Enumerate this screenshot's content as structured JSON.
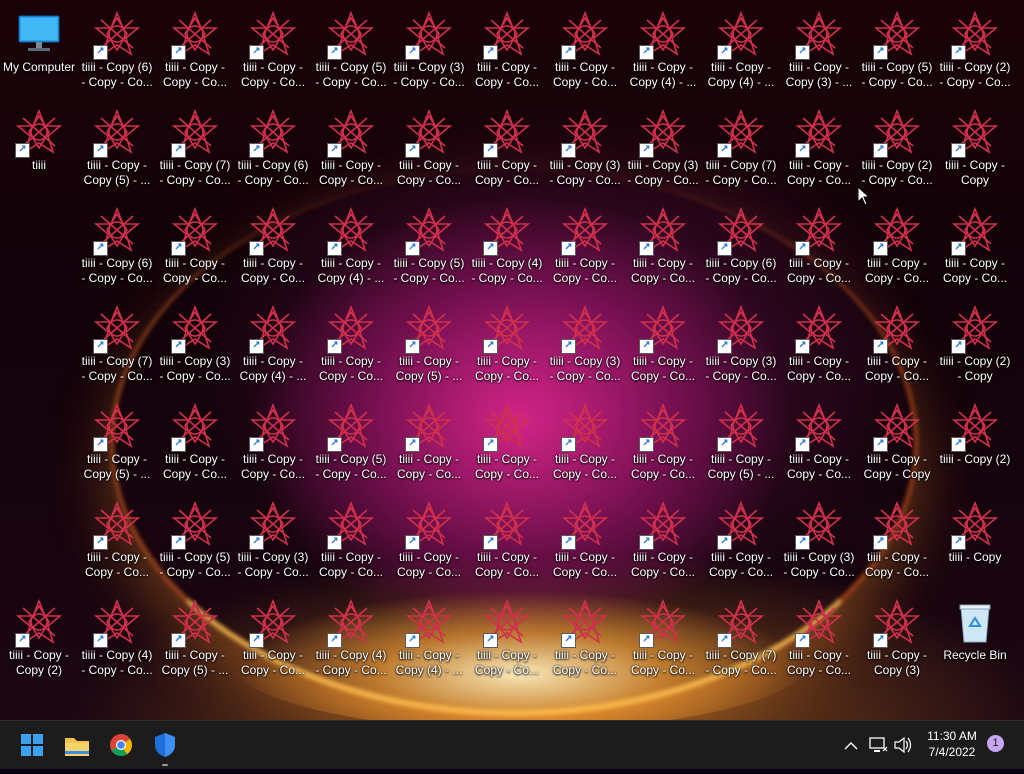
{
  "colors": {
    "taskbar": "#1c1c1c",
    "badge": "#c5a6f0"
  },
  "desktop": {
    "rows": [
      [
        "My Computer",
        "tiiii - Copy (6)\n- Copy - Co...",
        "tiiii - Copy -\nCopy - Co...",
        "tiiii - Copy -\nCopy - Co...",
        "tiiii - Copy (5)\n- Copy - Co...",
        "tiiii - Copy (3)\n- Copy - Co...",
        "tiiii - Copy -\nCopy - Co...",
        "tiiii - Copy -\nCopy - Co...",
        "tiiii - Copy -\nCopy (4) - ...",
        "tiiii - Copy -\nCopy (4) - ...",
        "tiiii - Copy -\nCopy (3) - ...",
        "tiiii - Copy (5)\n- Copy - Co...",
        "tiiii - Copy (2)\n- Copy - Co..."
      ],
      [
        "tiiii",
        "tiiii - Copy -\nCopy (5) - ...",
        "tiiii - Copy (7)\n- Copy - Co...",
        "tiiii - Copy (6)\n- Copy - Co...",
        "tiiii - Copy -\nCopy - Co...",
        "tiiii - Copy -\nCopy - Co...",
        "tiiii - Copy -\nCopy - Co...",
        "tiiii - Copy (3)\n- Copy - Co...",
        "tiiii - Copy (3)\n- Copy - Co...",
        "tiiii - Copy (7)\n- Copy - Co...",
        "tiiii - Copy -\nCopy - Co...",
        "tiiii - Copy (2)\n- Copy - Co...",
        "tiiii - Copy -\nCopy"
      ],
      [
        "",
        "tiiii - Copy (6)\n- Copy - Co...",
        "tiiii - Copy -\nCopy - Co...",
        "tiiii - Copy -\nCopy - Co...",
        "tiiii - Copy -\nCopy (4) - ...",
        "tiiii - Copy (5)\n- Copy - Co...",
        "tiiii - Copy (4)\n- Copy - Co...",
        "tiiii - Copy -\nCopy - Co...",
        "tiiii - Copy -\nCopy - Co...",
        "tiiii - Copy (6)\n- Copy - Co...",
        "tiiii - Copy -\nCopy - Co...",
        "tiiii - Copy -\nCopy - Co...",
        "tiiii - Copy -\nCopy - Co..."
      ],
      [
        "",
        "tiiii - Copy (7)\n- Copy - Co...",
        "tiiii - Copy (3)\n- Copy - Co...",
        "tiiii - Copy -\nCopy (4) - ...",
        "tiiii - Copy -\nCopy - Co...",
        "tiiii - Copy -\nCopy (5) - ...",
        "tiiii - Copy -\nCopy - Co...",
        "tiiii - Copy (3)\n- Copy - Co...",
        "tiiii - Copy -\nCopy - Co...",
        "tiiii - Copy (3)\n- Copy - Co...",
        "tiiii - Copy -\nCopy - Co...",
        "tiiii - Copy -\nCopy - Co...",
        "tiiii - Copy (2)\n- Copy"
      ],
      [
        "",
        "tiiii - Copy -\nCopy (5) - ...",
        "tiiii - Copy -\nCopy - Co...",
        "tiiii - Copy -\nCopy - Co...",
        "tiiii - Copy (5)\n- Copy - Co...",
        "tiiii - Copy -\nCopy - Co...",
        "tiiii - Copy -\nCopy - Co...",
        "tiiii - Copy -\nCopy - Co...",
        "tiiii - Copy -\nCopy - Co...",
        "tiiii - Copy -\nCopy (5) - ...",
        "tiiii - Copy -\nCopy - Co...",
        "tiiii - Copy -\nCopy - Copy",
        "tiiii - Copy (2)"
      ],
      [
        "",
        "tiiii - Copy -\nCopy - Co...",
        "tiiii - Copy (5)\n- Copy - Co...",
        "tiiii - Copy (3)\n- Copy - Co...",
        "tiiii - Copy -\nCopy - Co...",
        "tiiii - Copy -\nCopy - Co...",
        "tiiii - Copy -\nCopy - Co...",
        "tiiii - Copy -\nCopy - Co...",
        "tiiii - Copy -\nCopy - Co...",
        "tiiii - Copy -\nCopy - Co...",
        "tiiii - Copy (3)\n- Copy - Co...",
        "tiiii - Copy -\nCopy - Co...",
        "tiiii - Copy"
      ],
      [
        "tiiii - Copy -\nCopy (2)",
        "tiiii - Copy (4)\n- Copy - Co...",
        "tiiii - Copy -\nCopy (5) - ...",
        "tiiii - Copy -\nCopy - Co...",
        "tiiii - Copy (4)\n- Copy - Co...",
        "tiiii - Copy -\nCopy (4) - ...",
        "tiiii - Copy -\nCopy - Co...",
        "tiiii - Copy -\nCopy - Co...",
        "tiiii - Copy -\nCopy - Co...",
        "tiiii - Copy (7)\n- Copy - Co...",
        "tiiii - Copy -\nCopy - Co...",
        "tiiii - Copy -\nCopy (3)",
        "Recycle Bin"
      ]
    ]
  },
  "taskbar": {
    "start_icon": "windows-start-icon",
    "apps": [
      "file-explorer-icon",
      "chrome-icon",
      "windows-security-icon"
    ],
    "tray_icons": [
      "chevron-up-icon",
      "network-icon",
      "volume-icon"
    ],
    "time": "11:30 AM",
    "date": "7/4/2022",
    "notification_count": "1"
  }
}
